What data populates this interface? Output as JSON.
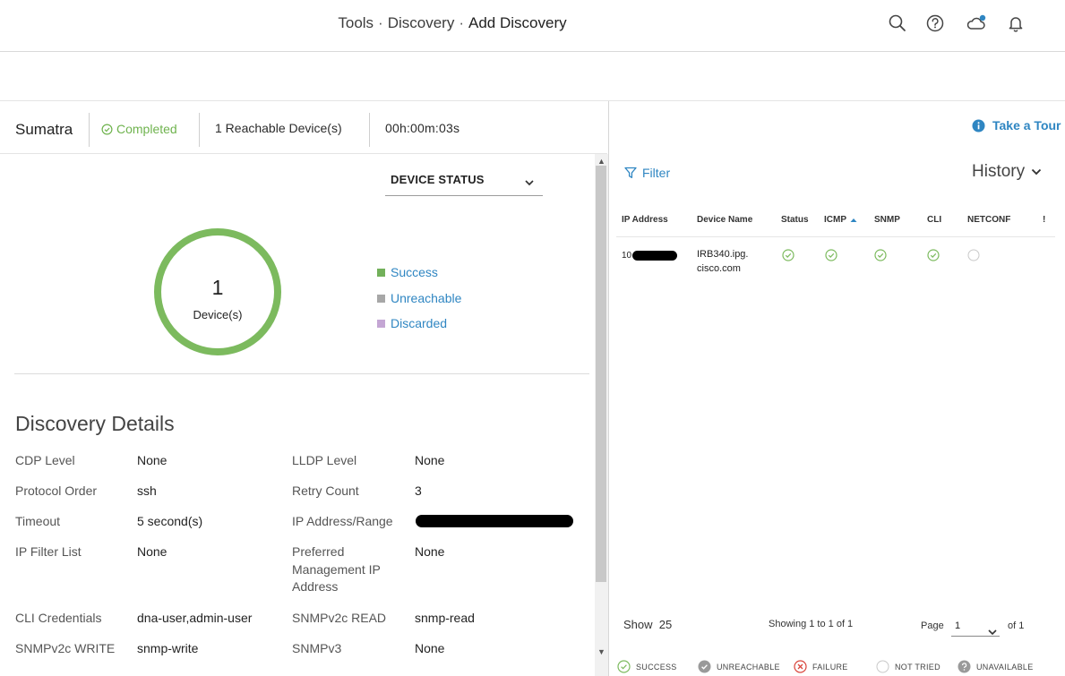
{
  "header": {
    "breadcrumb": [
      "Tools",
      "Discovery",
      "Add Discovery"
    ],
    "separator": "·",
    "icons": [
      "search-icon",
      "help-icon",
      "cloud-notification-icon",
      "bell-icon"
    ]
  },
  "summary": {
    "site_name": "Sumatra",
    "status": "Completed",
    "reachable": "1 Reachable Device(s)",
    "elapsed": "00h:00m:03s"
  },
  "device_status": {
    "dropdown_label": "DEVICE STATUS",
    "count": "1",
    "count_label": "Device(s)",
    "legend": [
      {
        "label": "Success",
        "color": "#72b05a"
      },
      {
        "label": "Unreachable",
        "color": "#a7a7a7"
      },
      {
        "label": "Discarded",
        "color": "#c4a6d4"
      }
    ],
    "ring_color": "#7cba5e"
  },
  "details": {
    "title": "Discovery Details",
    "rows": [
      {
        "k1": "CDP Level",
        "v1": "None",
        "k2": "LLDP Level",
        "v2": "None"
      },
      {
        "k1": "Protocol Order",
        "v1": "ssh",
        "k2": "Retry Count",
        "v2": "3"
      },
      {
        "k1": "Timeout",
        "v1": "5 second(s)",
        "k2": "IP Address/Range",
        "v2": ""
      },
      {
        "k1": "IP Filter List",
        "v1": "None",
        "k2": "Preferred Management IP Address",
        "v2": "None"
      },
      {
        "k1": "CLI Credentials",
        "v1": "dna-user,admin-user",
        "k2": "SNMPv2c READ",
        "v2": "snmp-read"
      },
      {
        "k1": "SNMPv2c WRITE",
        "v1": "snmp-write",
        "k2": "SNMPv3",
        "v2": "None"
      }
    ]
  },
  "right": {
    "tour_label": "Take a Tour",
    "filter_label": "Filter",
    "history_label": "History",
    "columns": [
      "IP Address",
      "Device Name",
      "Status",
      "ICMP",
      "SNMP",
      "CLI",
      "NETCONF",
      "!"
    ],
    "rows": [
      {
        "ip_prefix": "10",
        "device_name_line1": "IRB340.ipg.",
        "device_name_line2": "cisco.com",
        "status": "success",
        "icmp": "success",
        "snmp": "success",
        "cli": "success",
        "netconf": "not-tried"
      }
    ],
    "footer": {
      "show_label": "Show",
      "show_value": "25",
      "showing_text": "Showing 1 to 1 of 1",
      "page_label": "Page",
      "page_value": "1",
      "page_of": "of 1"
    },
    "legend": [
      {
        "label": "SUCCESS",
        "icon": "success-icon"
      },
      {
        "label": "UNREACHABLE",
        "icon": "unreachable-icon"
      },
      {
        "label": "FAILURE",
        "icon": "failure-icon"
      },
      {
        "label": "NOT TRIED",
        "icon": "not-tried-icon"
      },
      {
        "label": "UNAVAILABLE",
        "icon": "unavailable-icon"
      }
    ]
  }
}
